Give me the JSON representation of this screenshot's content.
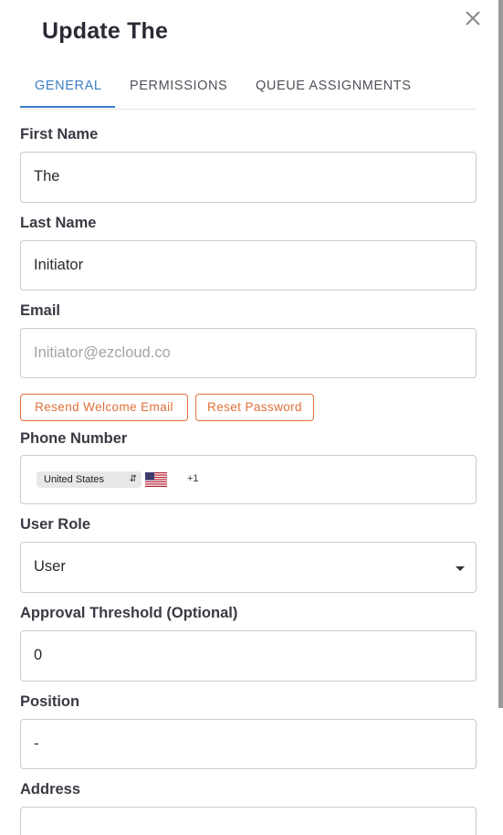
{
  "dialog": {
    "title": "Update The",
    "close_icon": "close-icon"
  },
  "tabs": [
    {
      "label": "GENERAL",
      "active": true
    },
    {
      "label": "PERMISSIONS",
      "active": false
    },
    {
      "label": "QUEUE ASSIGNMENTS",
      "active": false
    }
  ],
  "form": {
    "first_name": {
      "label": "First Name",
      "value": "The"
    },
    "last_name": {
      "label": "Last Name",
      "value": "Initiator"
    },
    "email": {
      "label": "Email",
      "placeholder": "Initiator@ezcloud.co"
    },
    "resend_button": "Resend Welcome Email",
    "reset_button": "Reset Password",
    "phone": {
      "label": "Phone Number",
      "country": "United States",
      "flag_icon": "us-flag-icon",
      "dial_code": "+1"
    },
    "role": {
      "label": "User Role",
      "value": "User"
    },
    "threshold": {
      "label": "Approval Threshold (Optional)",
      "value": "0"
    },
    "position": {
      "label": "Position",
      "value": "-"
    },
    "address": {
      "label": "Address",
      "value": ""
    }
  },
  "colors": {
    "accent_blue": "#3b7ec4",
    "accent_orange": "#e0713a",
    "border": "#c9cacf"
  }
}
